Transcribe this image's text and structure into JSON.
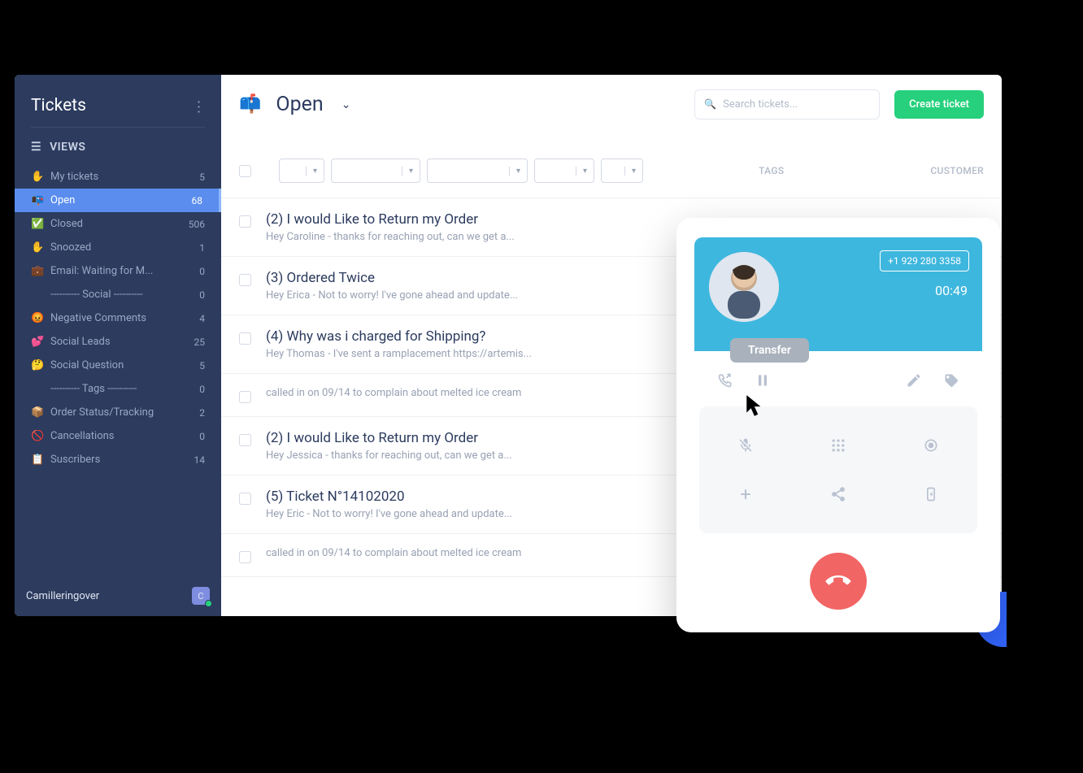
{
  "sidebar": {
    "title": "Tickets",
    "views_label": "VIEWS",
    "items": [
      {
        "icon": "✋",
        "label": "My tickets",
        "count": "5"
      },
      {
        "icon": "📭",
        "label": "Open",
        "count": "68",
        "active": true
      },
      {
        "icon": "✅",
        "label": "Closed",
        "count": "506"
      },
      {
        "icon": "✋",
        "label": "Snoozed",
        "count": "1"
      },
      {
        "icon": "💼",
        "label": "Email: Waiting for M...",
        "count": "0"
      },
      {
        "icon": "",
        "label": "---------- Social ----------",
        "count": "0",
        "sep": true
      },
      {
        "icon": "😡",
        "label": "Negative Comments",
        "count": "4"
      },
      {
        "icon": "💕",
        "label": "Social Leads",
        "count": "25"
      },
      {
        "icon": "🤔",
        "label": "Social Question",
        "count": "5"
      },
      {
        "icon": "",
        "label": "---------- Tags ----------",
        "count": "0",
        "sep": true
      },
      {
        "icon": "📦",
        "label": "Order Status/Tracking",
        "count": "2"
      },
      {
        "icon": "🚫",
        "label": "Cancellations",
        "count": "0"
      },
      {
        "icon": "📋",
        "label": "Suscribers",
        "count": "14"
      }
    ],
    "footer": {
      "user": "Camilleringover",
      "initial": "C"
    }
  },
  "topbar": {
    "view": "Open",
    "search_ph": "Search tickets...",
    "create": "Create ticket"
  },
  "filter": {
    "widths": [
      56,
      110,
      124,
      74,
      52
    ],
    "tags": "TAGS",
    "customer": "CUSTOMER"
  },
  "tickets": [
    {
      "title": "(2) I would Like to Return my Order",
      "preview": "Hey Caroline - thanks for reaching out, can we get a..."
    },
    {
      "title": "(3) Ordered Twice",
      "preview": "Hey Erica - Not to worry! I've gone ahead and update..."
    },
    {
      "title": "(4) Why was i charged for Shipping?",
      "preview": "Hey Thomas - I've sent a ramplacement https://artemis..."
    },
    {
      "preview": "called in on 09/14 to complain about melted ice cream",
      "slim": true
    },
    {
      "title": "(2) I would Like to Return my Order",
      "preview": "Hey Jessica - thanks for reaching out, can we get a..."
    },
    {
      "title": "(5) Ticket N°14102020",
      "preview": "Hey Eric - Not to worry! I've gone ahead and update..."
    },
    {
      "preview": "called in on 09/14 to complain about melted ice cream",
      "slim": true
    }
  ],
  "call": {
    "number": "+1 929 280 3358",
    "duration": "00:49",
    "transfer": "Transfer"
  }
}
